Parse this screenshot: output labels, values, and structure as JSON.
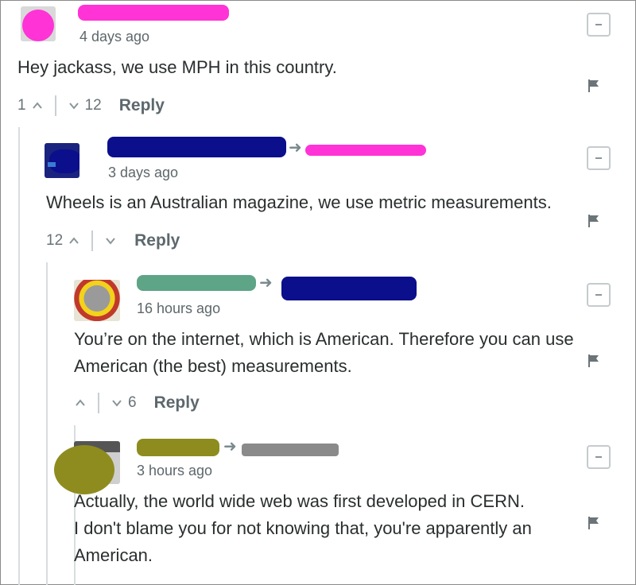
{
  "colors": {
    "redact_pink": "#ff33d6",
    "redact_navy": "#0b0f8c",
    "redact_olive": "#8e8c1e",
    "redact_gray": "#8a8a8a"
  },
  "comments": [
    {
      "time": "4 days ago",
      "text": "Hey jackass, we use MPH in this country.",
      "up": "1",
      "down": "12",
      "reply": "Reply"
    },
    {
      "time": "3 days ago",
      "text": "Wheels is an Australian magazine, we use metric measurements.",
      "up": "12",
      "down": "",
      "reply": "Reply"
    },
    {
      "time": "16 hours ago",
      "text_lines": [
        "You’re on the internet, which is American. Therefore you can use",
        "American (the best) measurements."
      ],
      "up": "",
      "down": "6",
      "reply": "Reply"
    },
    {
      "time": "3 hours ago",
      "text_lines": [
        "Actually, the world wide web was first developed in CERN.",
        "I don't blame you for not knowing that, you're apparently an",
        "American."
      ]
    }
  ],
  "icons": {
    "collapse": "collapse-icon",
    "flag": "flag-icon",
    "upvote": "chevron-up-icon",
    "downvote": "chevron-down-icon",
    "reply_arrow": "reply-arrow-icon"
  }
}
